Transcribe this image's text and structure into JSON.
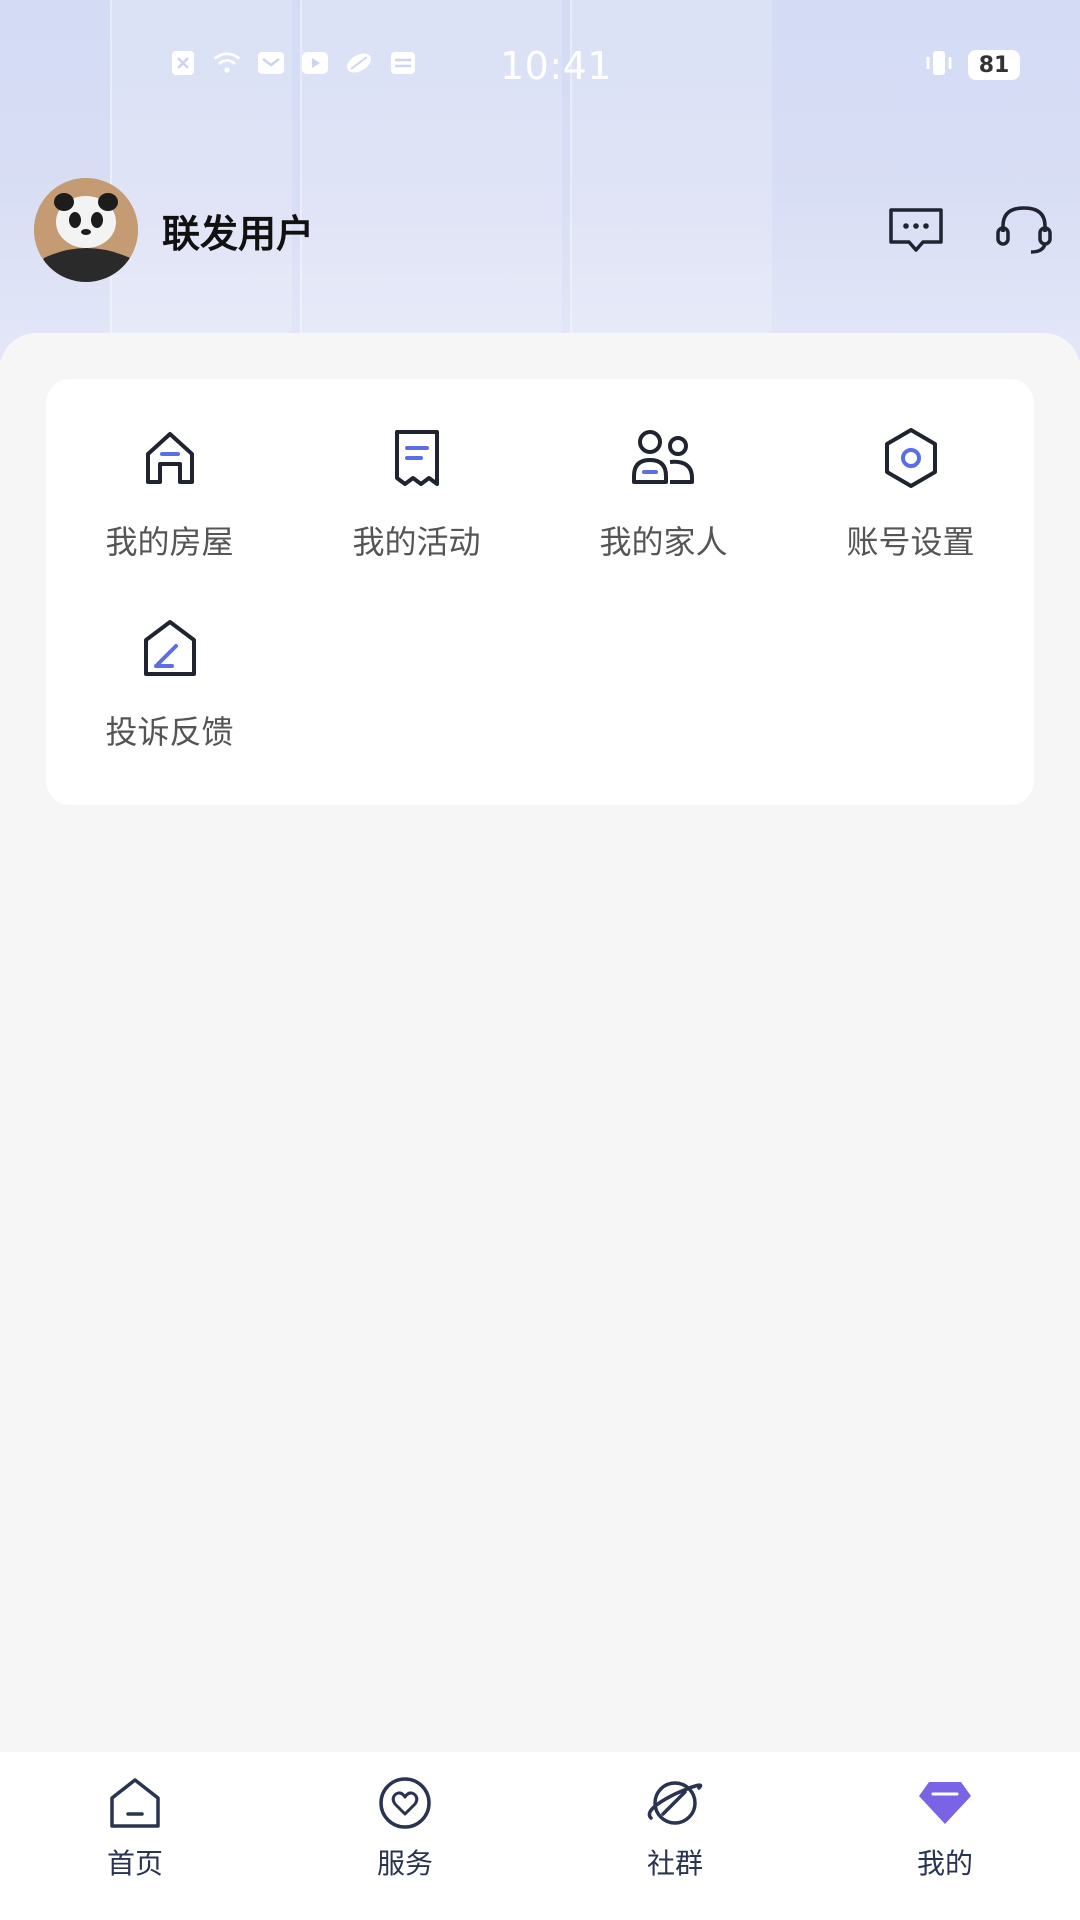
{
  "status_bar": {
    "time": "10:41",
    "battery": "81"
  },
  "user": {
    "name": "联发用户"
  },
  "menu": {
    "items": [
      {
        "label": "我的房屋",
        "icon": "house-icon"
      },
      {
        "label": "我的活动",
        "icon": "receipt-icon"
      },
      {
        "label": "我的家人",
        "icon": "family-icon"
      },
      {
        "label": "账号设置",
        "icon": "hexagon-settings-icon"
      },
      {
        "label": "投诉反馈",
        "icon": "feedback-edit-icon"
      }
    ]
  },
  "tabs": [
    {
      "label": "首页",
      "icon": "home-tab-icon"
    },
    {
      "label": "服务",
      "icon": "heart-circle-icon"
    },
    {
      "label": "社群",
      "icon": "planet-icon"
    },
    {
      "label": "我的",
      "icon": "gem-icon"
    }
  ],
  "colors": {
    "accent": "#5b6ee8",
    "tab_text": "#2a3350",
    "active_gem": "#7b63e6"
  }
}
